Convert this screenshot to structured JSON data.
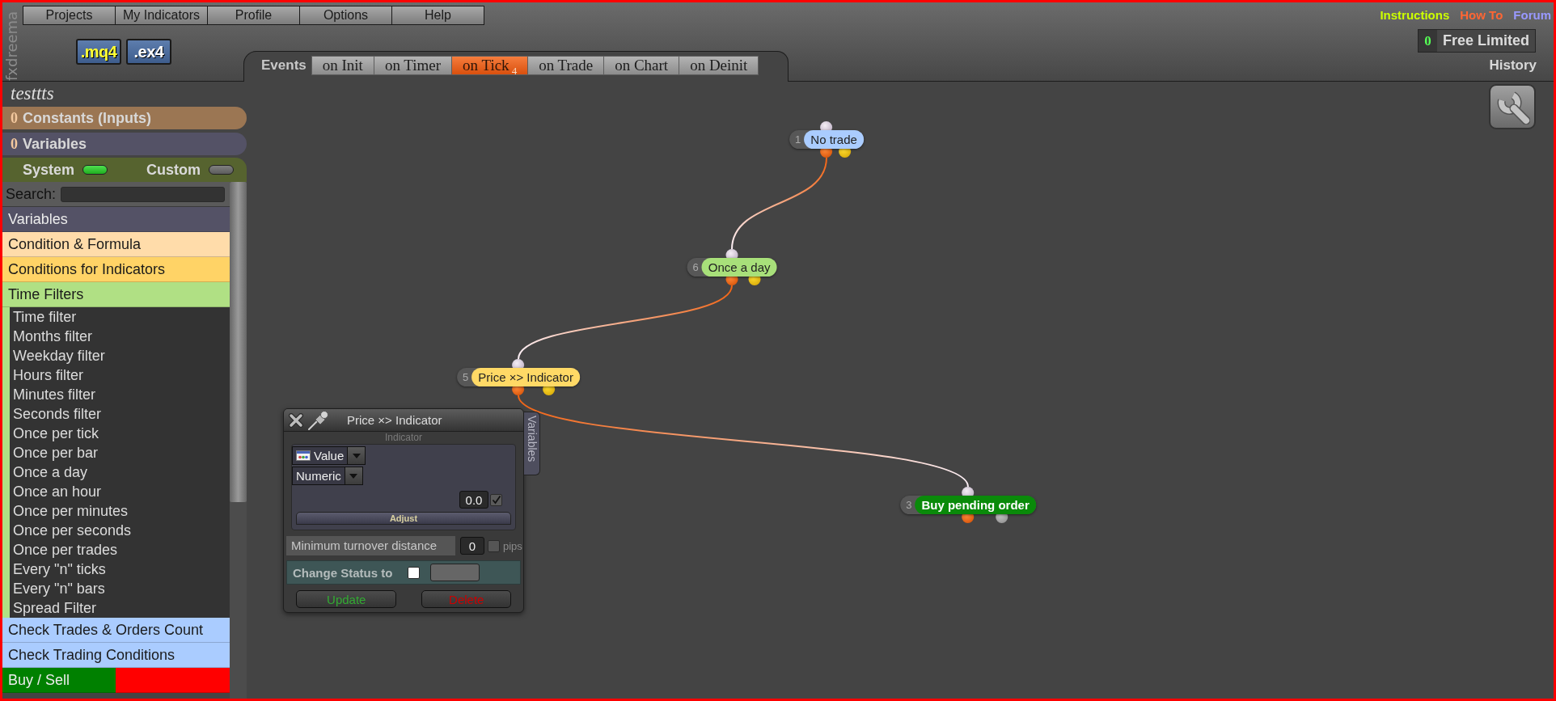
{
  "brand": "fxdreema",
  "menu": [
    {
      "label": "Projects"
    },
    {
      "label": "My Indicators"
    },
    {
      "label": "Profile"
    },
    {
      "label": "Options"
    },
    {
      "label": "Help"
    }
  ],
  "file_buttons": [
    {
      "label": ".mq4",
      "highlighted": true
    },
    {
      "label": ".ex4",
      "highlighted": false
    }
  ],
  "events": {
    "label": "Events",
    "tabs": [
      {
        "label": "on Init",
        "selected": false
      },
      {
        "label": "on Timer",
        "selected": false
      },
      {
        "label": "on Tick",
        "badge": "4",
        "selected": true
      },
      {
        "label": "on Trade",
        "selected": false
      },
      {
        "label": "on Chart",
        "selected": false
      },
      {
        "label": "on Deinit",
        "selected": false
      }
    ]
  },
  "header_links": [
    {
      "label": "Instructions",
      "color": "#ccff00"
    },
    {
      "label": "How To",
      "color": "#ff6633"
    },
    {
      "label": "Forum",
      "color": "#9999ff"
    }
  ],
  "license": {
    "count": "0",
    "label": "Free Limited"
  },
  "history": {
    "label": "History"
  },
  "sidebar": {
    "project": "testtts",
    "sections": [
      {
        "count": "0",
        "label": "Constants (Inputs)",
        "color": "#9b7653"
      },
      {
        "count": "0",
        "label": "Variables",
        "color": "#545266"
      }
    ],
    "toggles": [
      {
        "label": "System",
        "on": true
      },
      {
        "label": "Custom",
        "on": false
      }
    ],
    "search": {
      "label": "Search:"
    },
    "categories": [
      {
        "label": "Variables",
        "color": "#545266"
      },
      {
        "label": "Condition & Formula",
        "color": "#ffdcaa"
      },
      {
        "label": "Conditions for Indicators",
        "color": "#ffd366"
      },
      {
        "label": "Time Filters",
        "color": "#b0e084",
        "children": [
          {
            "label": "Time filter"
          },
          {
            "label": "Months filter"
          },
          {
            "label": "Weekday filter"
          },
          {
            "label": "Hours filter"
          },
          {
            "label": "Minutes filter"
          },
          {
            "label": "Seconds filter"
          },
          {
            "label": "Once per tick"
          },
          {
            "label": "Once per bar"
          },
          {
            "label": "Once a day"
          },
          {
            "label": "Once an hour"
          },
          {
            "label": "Once per minutes"
          },
          {
            "label": "Once per seconds"
          },
          {
            "label": "Once per trades"
          },
          {
            "label": "Every \"n\" ticks"
          },
          {
            "label": "Every \"n\" bars"
          },
          {
            "label": "Spread Filter"
          }
        ]
      },
      {
        "label": "Check Trades & Orders Count",
        "color": "#aaccff"
      },
      {
        "label": "Check Trading Conditions",
        "color": "#aaccff"
      },
      {
        "label": "Buy / Sell",
        "bands": [
          {
            "color": "#008000"
          },
          {
            "color": "#ff0000"
          }
        ]
      }
    ]
  },
  "canvas": {
    "nodes": [
      {
        "number": "1",
        "label": "No trade",
        "color": "#aaccff",
        "kind": "condition"
      },
      {
        "number": "6",
        "label": "Once a day",
        "color": "#a8e07a",
        "kind": "condition"
      },
      {
        "number": "5",
        "label": "Price ×> Indicator",
        "color": "#ffd966",
        "kind": "condition"
      },
      {
        "number": "3",
        "label": "Buy pending order",
        "color": "#0a8a0a",
        "kind": "action"
      }
    ]
  },
  "dialog": {
    "title": "Price ×> Indicator",
    "side_tab": "Variables",
    "section_label": "Indicator",
    "selects": [
      {
        "value": "Value"
      },
      {
        "value": "Numeric"
      }
    ],
    "number": {
      "value": "0.0",
      "checked": true
    },
    "adjust": "Adjust",
    "min_distance": {
      "label": "Minimum turnover distance",
      "value": "0",
      "checked": false,
      "unit": "pips"
    },
    "status": {
      "label": "Change Status to",
      "checked": false
    },
    "buttons": [
      {
        "label": "Update",
        "kind": "update"
      },
      {
        "label": "Delete",
        "kind": "delete"
      }
    ]
  }
}
